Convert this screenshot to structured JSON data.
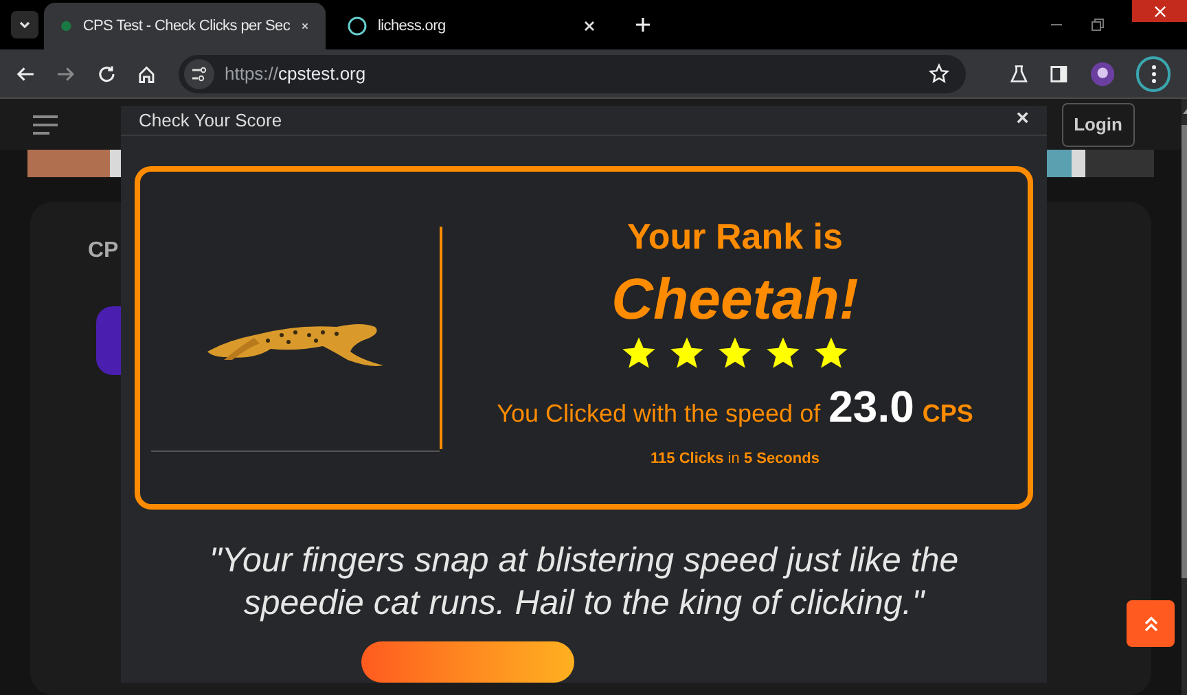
{
  "browser": {
    "tabs": [
      {
        "title": "CPS Test - Check Clicks per Sec",
        "selected": true
      },
      {
        "title": "lichess.org",
        "selected": false
      }
    ],
    "url_scheme": "https://",
    "url_host": "cpstest.org"
  },
  "site_header": {
    "login": "Login"
  },
  "background": {
    "card_title": "CP"
  },
  "modal": {
    "title": "Check Your Score",
    "close": "×",
    "result": {
      "heading": "Your Rank is",
      "rank": "Cheetah!",
      "stars": 5,
      "speed_prefix": "You Clicked with the speed of",
      "speed_value": "23.0",
      "speed_unit": "CPS",
      "summary": "**115 Clicks** in **5 Seconds**"
    },
    "quote": "\"Your fingers snap at blistering speed just like the speedie cat runs. Hail to the king of clicking.\""
  }
}
